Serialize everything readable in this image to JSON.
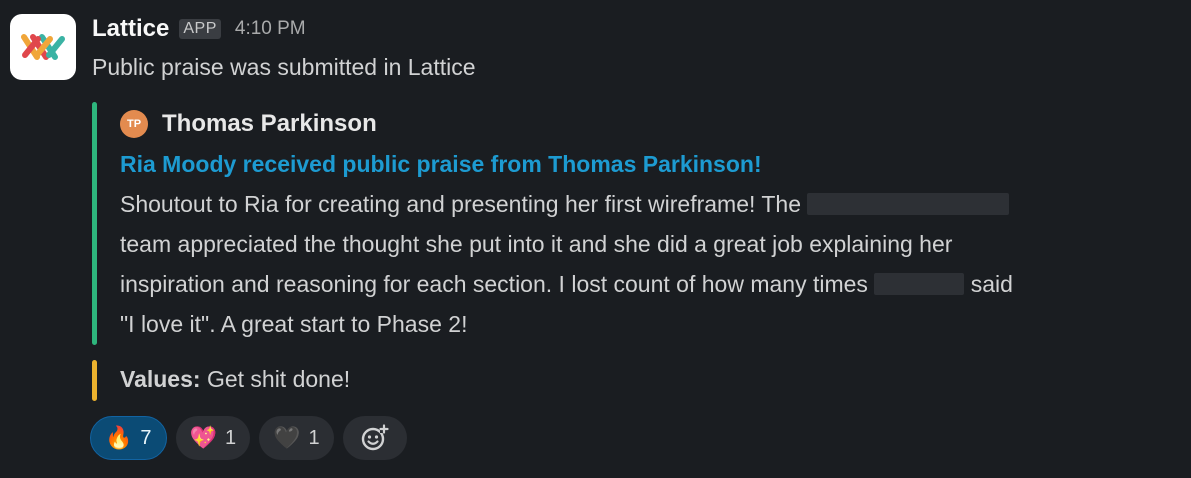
{
  "message": {
    "app_name": "Lattice",
    "app_badge": "APP",
    "timestamp": "4:10 PM",
    "text": "Public praise was submitted in Lattice"
  },
  "attachment": {
    "accent_color": "#2eb67d",
    "author_initials": "TP",
    "author_name": "Thomas Parkinson",
    "title": "Ria Moody received public praise from Thomas Parkinson!",
    "body": {
      "l1": "Shoutout to Ria for creating and presenting her first wireframe! The",
      "l2": "team appreciated the thought she put into it and she did a great job explaining her",
      "l3a": "inspiration and reasoning for each section. I lost count of how many times",
      "l3b": "said",
      "l4": "\"I love it\". A great start to Phase 2!"
    }
  },
  "field": {
    "accent_color": "#ecb22e",
    "label": "Values:",
    "value": "Get shit done!"
  },
  "reactions": [
    {
      "emoji": "🔥",
      "icon": "fire-icon",
      "count": "7",
      "active": true
    },
    {
      "emoji": "💖",
      "icon": "sparkling-heart-icon",
      "count": "1",
      "active": false
    },
    {
      "emoji": "🖤",
      "icon": "black-heart-icon",
      "count": "1",
      "active": false
    }
  ],
  "add_reaction_icon": "add-reaction-icon"
}
